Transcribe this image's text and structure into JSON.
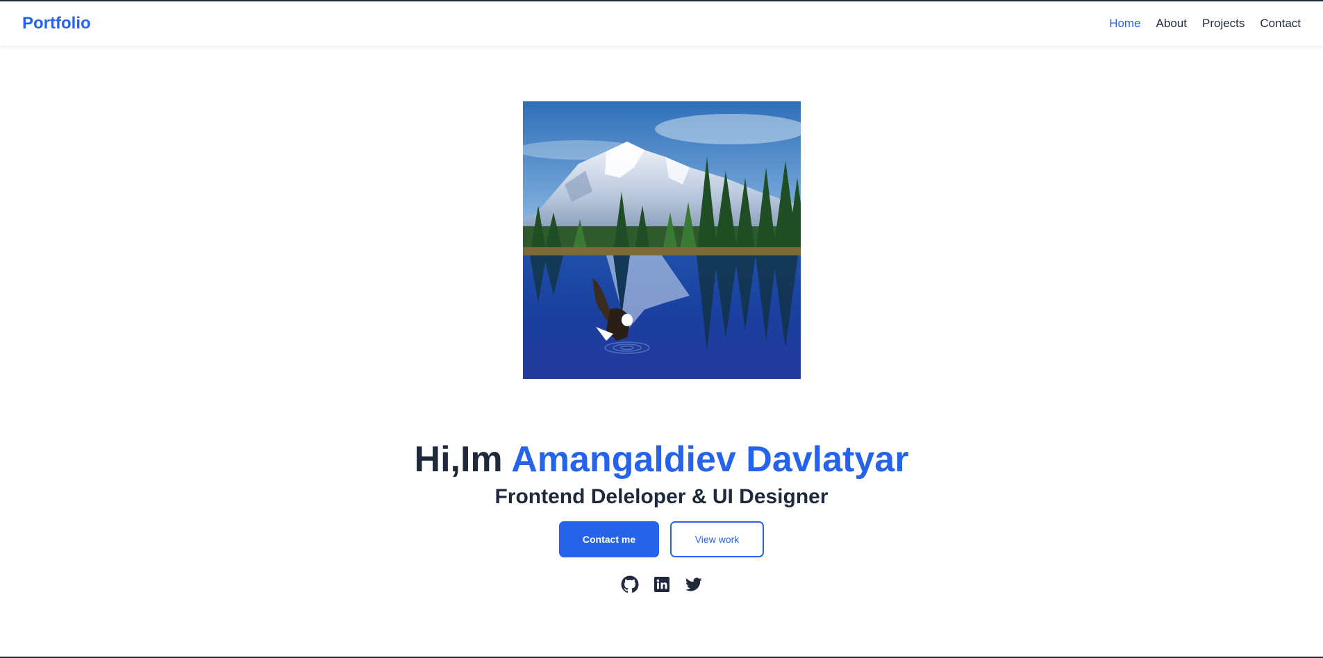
{
  "nav": {
    "brand": "Portfolio",
    "links": [
      {
        "label": "Home",
        "active": true
      },
      {
        "label": "About",
        "active": false
      },
      {
        "label": "Projects",
        "active": false
      },
      {
        "label": "Contact",
        "active": false
      }
    ]
  },
  "hero": {
    "greeting": "Hi,Im ",
    "name": "Amangaldiev Davlatyar",
    "subtitle": "Frontend Deleloper & UI Designer",
    "contact_button": "Contact me",
    "work_button": "View work",
    "image_alt": "mountain-lake-eagle-photo"
  },
  "socials": [
    {
      "icon": "github-icon"
    },
    {
      "icon": "linkedin-icon"
    },
    {
      "icon": "twitter-icon"
    }
  ],
  "colors": {
    "accent": "#2563eb",
    "text": "#1e293b"
  }
}
